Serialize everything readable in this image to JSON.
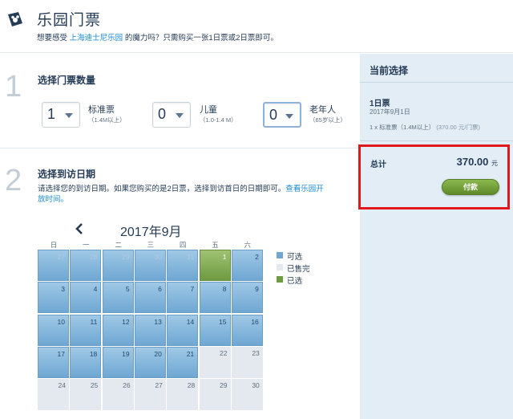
{
  "header": {
    "title": "乐园门票",
    "subtitle_pre": "想要感受",
    "subtitle_link": "上海迪士尼乐园",
    "subtitle_post": "的魔力吗？只需购买一张1日票或2日票即可。"
  },
  "step1": {
    "number": "1",
    "title": "选择门票数量",
    "tickets": [
      {
        "qty": "1",
        "label": "标准票",
        "sub": "（1.4M以上）"
      },
      {
        "qty": "0",
        "label": "儿童",
        "sub": "（1.0-1.4 M）"
      },
      {
        "qty": "0",
        "label": "老年人",
        "sub": "（65岁以上）"
      }
    ]
  },
  "step2": {
    "number": "2",
    "title": "选择到访日期",
    "desc_pre": "请选择您的到访日期。如果您购买的是2日票，选择到访首日的日期即可。",
    "desc_link": "查看乐园开放时间。"
  },
  "calendar": {
    "month_title": "2017年9月",
    "weekdays": [
      "日",
      "一",
      "二",
      "三",
      "四",
      "五",
      "六"
    ],
    "weeks": [
      [
        {
          "d": "27",
          "s": "past"
        },
        {
          "d": "28",
          "s": "past"
        },
        {
          "d": "29",
          "s": "past"
        },
        {
          "d": "30",
          "s": "past"
        },
        {
          "d": "31",
          "s": "past"
        },
        {
          "d": "1",
          "s": "sel"
        },
        {
          "d": "2",
          "s": "avail"
        }
      ],
      [
        {
          "d": "3",
          "s": "avail"
        },
        {
          "d": "4",
          "s": "avail"
        },
        {
          "d": "5",
          "s": "avail"
        },
        {
          "d": "6",
          "s": "avail"
        },
        {
          "d": "7",
          "s": "avail"
        },
        {
          "d": "8",
          "s": "avail"
        },
        {
          "d": "9",
          "s": "avail"
        }
      ],
      [
        {
          "d": "10",
          "s": "avail"
        },
        {
          "d": "11",
          "s": "avail"
        },
        {
          "d": "12",
          "s": "avail"
        },
        {
          "d": "13",
          "s": "avail"
        },
        {
          "d": "14",
          "s": "avail"
        },
        {
          "d": "15",
          "s": "avail"
        },
        {
          "d": "16",
          "s": "avail"
        }
      ],
      [
        {
          "d": "17",
          "s": "avail"
        },
        {
          "d": "18",
          "s": "avail"
        },
        {
          "d": "19",
          "s": "avail"
        },
        {
          "d": "20",
          "s": "avail"
        },
        {
          "d": "21",
          "s": "avail"
        },
        {
          "d": "22",
          "s": "sold"
        },
        {
          "d": "23",
          "s": "sold"
        }
      ],
      [
        {
          "d": "24",
          "s": "sold"
        },
        {
          "d": "25",
          "s": "sold"
        },
        {
          "d": "26",
          "s": "sold"
        },
        {
          "d": "27",
          "s": "sold"
        },
        {
          "d": "28",
          "s": "sold"
        },
        {
          "d": "29",
          "s": "sold"
        },
        {
          "d": "30",
          "s": "sold"
        }
      ]
    ],
    "legend": [
      {
        "label": "可选",
        "color": "#6fa7d2"
      },
      {
        "label": "已售完",
        "color": "#e3e9ee"
      },
      {
        "label": "已选",
        "color": "#6e9a40"
      }
    ]
  },
  "summary": {
    "title": "当前选择",
    "ticket_type": "1日票",
    "ticket_date": "2017年9月1日",
    "line_main": "1 x 标准票（1.4M以上）",
    "line_price": "(370.00 元/门票)",
    "total_label": "总计",
    "total_value": "370.00",
    "total_unit": "元",
    "pay_label": "付款"
  },
  "colors": {
    "available": "#6fa7d2",
    "sold_out": "#e3e9ee",
    "selected": "#6e9a40",
    "highlight_border": "#e0181e",
    "link": "#1a8ad4"
  }
}
